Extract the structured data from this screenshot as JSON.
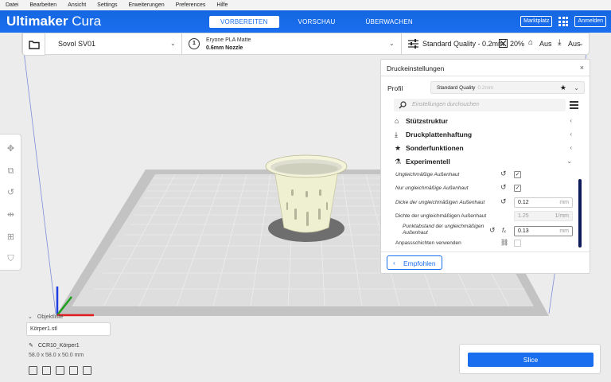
{
  "menu": [
    "Datei",
    "Bearbeiten",
    "Ansicht",
    "Settings",
    "Erweiterungen",
    "Preferences",
    "Hilfe"
  ],
  "header": {
    "logo_bold": "Ultimaker",
    "logo_light": "Cura",
    "stages": [
      "VORBEREITEN",
      "VORSCHAU",
      "ÜBERWACHEN"
    ],
    "active_stage": "VORBEREITEN",
    "marketplace": "Marktplatz",
    "signin": "Anmelden"
  },
  "toolbar": {
    "printer": "Sovol SV01",
    "extruder_index": "1",
    "material": "Eryone PLA Matte",
    "nozzle": "0.6mm Nozzle",
    "quality": "Standard Quality - 0.2mm",
    "infill": "20%",
    "support": "Aus",
    "adhesion": "Aus"
  },
  "panel": {
    "title": "Druckeinstellungen",
    "profile_label": "Profil",
    "profile_name": "Standard Quality",
    "profile_layer": "0.2mm",
    "search_placeholder": "Einstellungen durchsuchen",
    "categories": [
      {
        "label": "Stützstruktur",
        "icon": "support-icon"
      },
      {
        "label": "Druckplattenhaftung",
        "icon": "adhesion-icon"
      },
      {
        "label": "Sonderfunktionen",
        "icon": "star-icon"
      },
      {
        "label": "Experimentell",
        "icon": "flask-icon"
      }
    ],
    "settings": [
      {
        "label": "Ungleichmäßige Außenhaut",
        "type": "checkbox",
        "checked": true
      },
      {
        "label": "Nur ungleichmäßige Außenhaut",
        "type": "checkbox",
        "checked": true
      },
      {
        "label": "Dicke der ungleichmäßigen Außenhaut",
        "value": "0.12",
        "unit": "mm"
      },
      {
        "label": "Dichte der ungleichmäßigen Außenhaut",
        "value": "1.25",
        "unit": "1/mm"
      },
      {
        "label_line1": "Punktabstand der ungleichmäßigen",
        "label_line2": "Außenhaut",
        "value": "0.13",
        "unit": "mm"
      },
      {
        "label": "Anpassschichten verwenden",
        "type": "checkbox",
        "checked": false
      }
    ],
    "recommended": "Empfohlen"
  },
  "objects": {
    "toggle": "Objektliste",
    "file": "Körper1.stl",
    "job_name": "CCR10_Körper1",
    "dimensions": "58.0 x 58.0 x 50.0 mm"
  },
  "slice": {
    "label": "Slice"
  },
  "colors": {
    "accent": "#196EF0",
    "scrollbar": "#0E1D5A",
    "axis_x": "#E02020",
    "axis_y": "#1DA01D",
    "axis_z": "#1F3DE0"
  }
}
